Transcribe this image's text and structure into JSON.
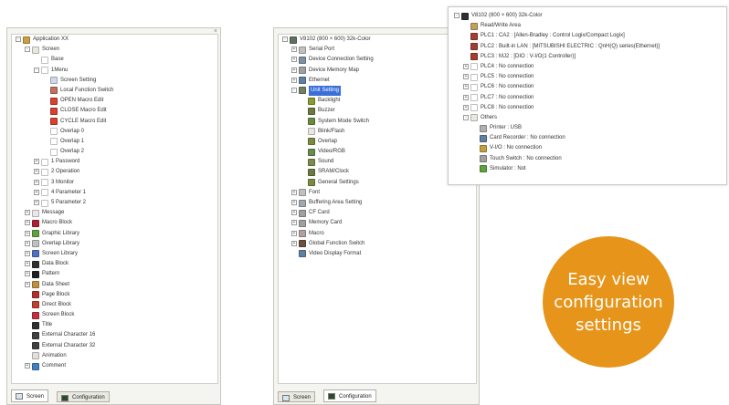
{
  "colors": {
    "accent": "#e6951a",
    "selection": "#3a6fd8",
    "panel_bg": "#f4f4f0"
  },
  "left_panel": {
    "close_label": "×",
    "tabs": [
      {
        "label": "Screen",
        "icon": "screen-tab-icon",
        "active": true
      },
      {
        "label": "Configuration",
        "icon": "configuration-tab-icon",
        "active": false
      }
    ],
    "tree": [
      {
        "label": "Application XX",
        "depth": 0,
        "exp": "-",
        "color": "#c8a040"
      },
      {
        "label": "Screen",
        "depth": 1,
        "exp": "-",
        "color": "#e8e8e0"
      },
      {
        "label": "Base",
        "depth": 2,
        "exp": "",
        "color": "#ffffff"
      },
      {
        "label": "1Menu",
        "depth": 2,
        "exp": "-",
        "color": "#ffffff"
      },
      {
        "label": "Screen Setting",
        "depth": 3,
        "exp": "",
        "color": "#d0d8e8"
      },
      {
        "label": "Local Function Switch",
        "depth": 3,
        "exp": "",
        "color": "#c07060"
      },
      {
        "label": "OPEN Macro Edit",
        "depth": 3,
        "exp": "",
        "color": "#d84030"
      },
      {
        "label": "CLOSE Macro Edit",
        "depth": 3,
        "exp": "",
        "color": "#d84030"
      },
      {
        "label": "CYCLE Macro Edit",
        "depth": 3,
        "exp": "",
        "color": "#d84030"
      },
      {
        "label": "Overlap 0",
        "depth": 3,
        "exp": "",
        "color": "#ffffff"
      },
      {
        "label": "Overlap 1",
        "depth": 3,
        "exp": "",
        "color": "#ffffff"
      },
      {
        "label": "Overlap 2",
        "depth": 3,
        "exp": "",
        "color": "#ffffff"
      },
      {
        "label": "1 Password",
        "depth": 2,
        "exp": "+",
        "color": "#ffffff"
      },
      {
        "label": "2 Operation",
        "depth": 2,
        "exp": "+",
        "color": "#ffffff"
      },
      {
        "label": "3 Monitor",
        "depth": 2,
        "exp": "+",
        "color": "#ffffff"
      },
      {
        "label": "4 Parameter 1",
        "depth": 2,
        "exp": "+",
        "color": "#ffffff"
      },
      {
        "label": "5 Parameter 2",
        "depth": 2,
        "exp": "+",
        "color": "#ffffff"
      },
      {
        "label": "Message",
        "depth": 1,
        "exp": "+",
        "color": "#e8e8e8"
      },
      {
        "label": "Macro Block",
        "depth": 1,
        "exp": "+",
        "color": "#b02030"
      },
      {
        "label": "Graphic Library",
        "depth": 1,
        "exp": "+",
        "color": "#60a040"
      },
      {
        "label": "Overlap Library",
        "depth": 1,
        "exp": "+",
        "color": "#c0c0c0"
      },
      {
        "label": "Screen Library",
        "depth": 1,
        "exp": "+",
        "color": "#5070c0"
      },
      {
        "label": "Data Block",
        "depth": 1,
        "exp": "+",
        "color": "#303030"
      },
      {
        "label": "Pattern",
        "depth": 1,
        "exp": "+",
        "color": "#202020"
      },
      {
        "label": "Data Sheet",
        "depth": 1,
        "exp": "+",
        "color": "#c09040"
      },
      {
        "label": "Page Block",
        "depth": 1,
        "exp": "",
        "color": "#b03030"
      },
      {
        "label": "Direct Block",
        "depth": 1,
        "exp": "",
        "color": "#c04030"
      },
      {
        "label": "Screen Block",
        "depth": 1,
        "exp": "",
        "color": "#c03040"
      },
      {
        "label": "Title",
        "depth": 1,
        "exp": "",
        "color": "#303030"
      },
      {
        "label": "External Character 16",
        "depth": 1,
        "exp": "",
        "color": "#404040"
      },
      {
        "label": "External Character 32",
        "depth": 1,
        "exp": "",
        "color": "#404040"
      },
      {
        "label": "Animation",
        "depth": 1,
        "exp": "",
        "color": "#e0e0e0"
      },
      {
        "label": "Comment",
        "depth": 1,
        "exp": "+",
        "color": "#4080c0"
      }
    ]
  },
  "middle_panel": {
    "tabs": [
      {
        "label": "Screen",
        "icon": "screen-tab-icon",
        "active": false
      },
      {
        "label": "Configuration",
        "icon": "configuration-tab-icon",
        "active": true
      }
    ],
    "tree": [
      {
        "label": "V8102 (800 × 600) 32k-Color",
        "depth": 0,
        "exp": "-",
        "color": "#607060",
        "sel": false
      },
      {
        "label": "Serial Port",
        "depth": 1,
        "exp": "+",
        "color": "#c0c0c0",
        "sel": false
      },
      {
        "label": "Device Connection Setting",
        "depth": 1,
        "exp": "+",
        "color": "#8090a0",
        "sel": false
      },
      {
        "label": "Device Memory Map",
        "depth": 1,
        "exp": "+",
        "color": "#a0a0a0",
        "sel": false
      },
      {
        "label": "Ethernet",
        "depth": 1,
        "exp": "+",
        "color": "#6080a0",
        "sel": false
      },
      {
        "label": "Unit Setting",
        "depth": 1,
        "exp": "-",
        "color": "#708060",
        "sel": true
      },
      {
        "label": "Backlight",
        "depth": 2,
        "exp": "",
        "color": "#8a9a30",
        "sel": false
      },
      {
        "label": "Buzzer",
        "depth": 2,
        "exp": "",
        "color": "#6a7a40",
        "sel": false
      },
      {
        "label": "System Mode Switch",
        "depth": 2,
        "exp": "",
        "color": "#6a8a40",
        "sel": false
      },
      {
        "label": "Blink/Flash",
        "depth": 2,
        "exp": "",
        "color": "#e8e8e0",
        "sel": false
      },
      {
        "label": "Overlap",
        "depth": 2,
        "exp": "",
        "color": "#7a8a40",
        "sel": false
      },
      {
        "label": "Video/RGB",
        "depth": 2,
        "exp": "",
        "color": "#6a8a50",
        "sel": false
      },
      {
        "label": "Sound",
        "depth": 2,
        "exp": "",
        "color": "#7a8a50",
        "sel": false
      },
      {
        "label": "SRAM/Clock",
        "depth": 2,
        "exp": "",
        "color": "#6a7a40",
        "sel": false
      },
      {
        "label": "General Settings",
        "depth": 2,
        "exp": "",
        "color": "#7a8a40",
        "sel": false
      },
      {
        "label": "Font",
        "depth": 1,
        "exp": "+",
        "color": "#c0c0c0",
        "sel": false
      },
      {
        "label": "Buffering Area Setting",
        "depth": 1,
        "exp": "+",
        "color": "#a0a8b0",
        "sel": false
      },
      {
        "label": "CF Card",
        "depth": 1,
        "exp": "+",
        "color": "#a0a0a0",
        "sel": false
      },
      {
        "label": "Memory Card",
        "depth": 1,
        "exp": "+",
        "color": "#a0a0a0",
        "sel": false
      },
      {
        "label": "Macro",
        "depth": 1,
        "exp": "+",
        "color": "#b0a0a0",
        "sel": false
      },
      {
        "label": "Global Function Switch",
        "depth": 1,
        "exp": "+",
        "color": "#6a5040",
        "sel": false
      },
      {
        "label": "Video Display Format",
        "depth": 1,
        "exp": "",
        "color": "#6080a0",
        "sel": false
      }
    ]
  },
  "right_panel": {
    "tree": [
      {
        "label": "V8102 (800 × 600) 32k-Color",
        "depth": 0,
        "exp": "-",
        "color": "#303030"
      },
      {
        "label": "Read/Write Area",
        "depth": 1,
        "exp": "",
        "color": "#c0a060"
      },
      {
        "label": "PLC1 : CA2 : [Allen-Bradley : Control Logix/Compact Logix]",
        "depth": 1,
        "exp": "",
        "color": "#a04030"
      },
      {
        "label": "PLC2 : Built-in LAN : [MITSUBISHI ELECTRIC : QnH(Q) series(Ethernet)]",
        "depth": 1,
        "exp": "",
        "color": "#a04030"
      },
      {
        "label": "PLC3 : MJ2 : [DIO : V-I/O(1 Controller)]",
        "depth": 1,
        "exp": "",
        "color": "#a04030"
      },
      {
        "label": "PLC4 : No connection",
        "depth": 1,
        "exp": "+",
        "color": "#ffffff"
      },
      {
        "label": "PLC5 : No connection",
        "depth": 1,
        "exp": "+",
        "color": "#ffffff"
      },
      {
        "label": "PLC6 : No connection",
        "depth": 1,
        "exp": "+",
        "color": "#ffffff"
      },
      {
        "label": "PLC7 : No connection",
        "depth": 1,
        "exp": "+",
        "color": "#ffffff"
      },
      {
        "label": "PLC8 : No connection",
        "depth": 1,
        "exp": "+",
        "color": "#ffffff"
      },
      {
        "label": "Others",
        "depth": 1,
        "exp": "-",
        "color": "#e8e8e0"
      },
      {
        "label": "Printer : USB",
        "depth": 2,
        "exp": "",
        "color": "#b0b0b0"
      },
      {
        "label": "Card Recorder : No connection",
        "depth": 2,
        "exp": "",
        "color": "#6080a0"
      },
      {
        "label": "V-I/O : No connection",
        "depth": 2,
        "exp": "",
        "color": "#c0a040"
      },
      {
        "label": "Touch Switch : No connection",
        "depth": 2,
        "exp": "",
        "color": "#a0a0a0"
      },
      {
        "label": "Simulator : Not",
        "depth": 2,
        "exp": "",
        "color": "#60a040"
      }
    ]
  },
  "badge": {
    "lines": [
      "Easy view",
      "configuration",
      "settings"
    ]
  }
}
